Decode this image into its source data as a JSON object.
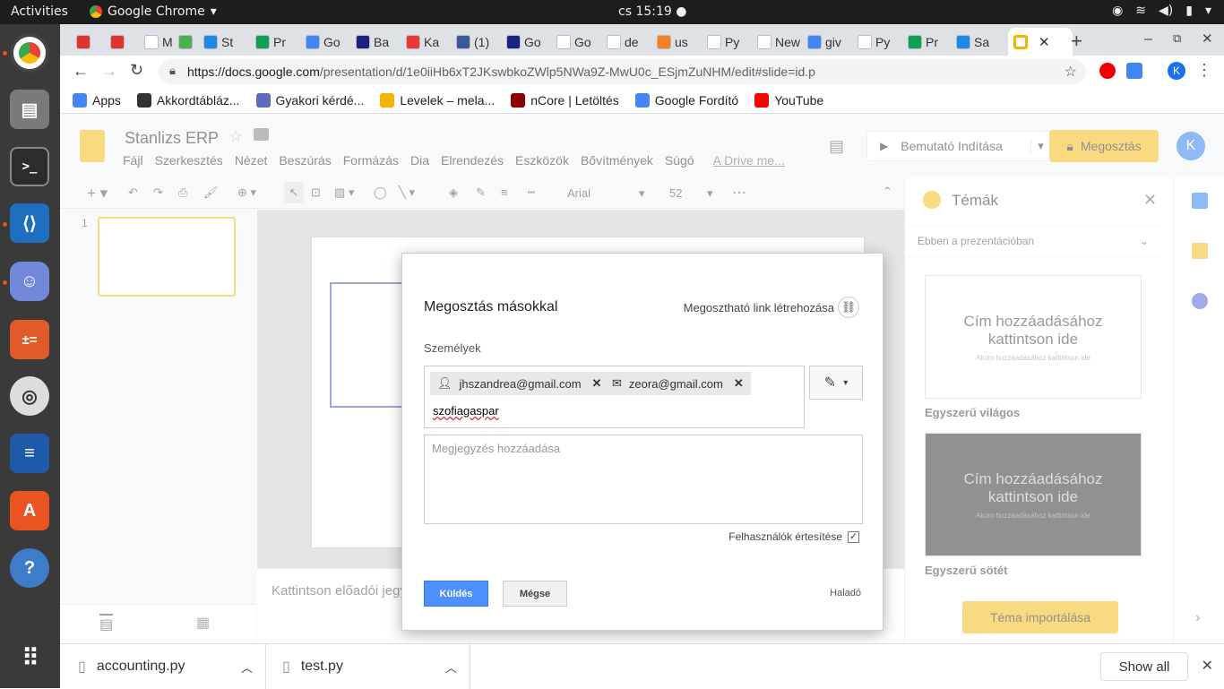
{
  "topbar": {
    "activities": "Activities",
    "app": "Google Chrome",
    "clock": "cs 15:19"
  },
  "tabs": [
    {
      "label": "",
      "color": "#d33"
    },
    {
      "label": "",
      "color": "#d33"
    },
    {
      "label": "M",
      "color": "#fff"
    },
    {
      "label": "",
      "color": "#4caf50"
    },
    {
      "label": "St",
      "color": "#1e88e5"
    },
    {
      "label": "Pr",
      "color": "#0f9d58"
    },
    {
      "label": "Go",
      "color": "#4285f4"
    },
    {
      "label": "Ba",
      "color": "#1a237e"
    },
    {
      "label": "Ka",
      "color": "#e53935"
    },
    {
      "label": "(1)",
      "color": "#3b5998"
    },
    {
      "label": "Go",
      "color": "#1a237e"
    },
    {
      "label": "Go",
      "color": "#fff"
    },
    {
      "label": "de",
      "color": "#fff"
    },
    {
      "label": "us",
      "color": "#f48024"
    },
    {
      "label": "Py",
      "color": "#fff"
    },
    {
      "label": "New T",
      "color": "#fff"
    },
    {
      "label": "giv",
      "color": "#4285f4"
    },
    {
      "label": "Py",
      "color": "#fff"
    },
    {
      "label": "Pr",
      "color": "#0f9d58"
    },
    {
      "label": "Sa",
      "color": "#1e88e5"
    }
  ],
  "url": {
    "host": "https://docs.google.com",
    "path": "/presentation/d/1e0iiHb6xT2JKswbkoZWlp5NWa9Z-MwU0c_ESjmZuNHM/edit#slide=id.p"
  },
  "bookmarks": [
    {
      "label": "Apps",
      "color": "#4285f4"
    },
    {
      "label": "Akkordtábláz...",
      "color": "#333"
    },
    {
      "label": "Gyakori kérdé...",
      "color": "#5c6bc0"
    },
    {
      "label": "Levelek – mela...",
      "color": "#f4b400"
    },
    {
      "label": "nCore | Letöltés",
      "color": "#8b0000"
    },
    {
      "label": "Google Fordító",
      "color": "#4285f4"
    },
    {
      "label": "YouTube",
      "color": "#ff0000"
    }
  ],
  "doc": {
    "title": "Stanlizs ERP",
    "menu": [
      "Fájl",
      "Szerkesztés",
      "Nézet",
      "Beszúrás",
      "Formázás",
      "Dia",
      "Elrendezés",
      "Eszközök",
      "Bővítmények",
      "Súgó"
    ],
    "drive_link": "A Drive me...",
    "present": "Bemutató Indítása",
    "share": "Megosztás",
    "avatar": "K",
    "font": "Arial",
    "font_size": "52",
    "slide_number": "1",
    "notes_placeholder": "Kattintson előadói jegy"
  },
  "themes": {
    "title": "Témák",
    "scope": "Ebben a prezentációban",
    "cards": [
      {
        "heading": "Cím hozzáadásához kattintson ide",
        "sub": "Alcím hozzáadásához kattintson ide",
        "name": "Egyszerű világos"
      },
      {
        "heading": "Cím hozzáadásához kattintson ide",
        "sub": "Alcím hozzáadásához kattintson ide",
        "name": "Egyszerű sötét"
      }
    ],
    "import": "Téma importálása"
  },
  "dialog": {
    "title": "Megosztás másokkal",
    "link_label": "Megosztható link létrehozása",
    "people_label": "Személyek",
    "chips": [
      "jhszandrea@gmail.com",
      "zeora@gmail.com"
    ],
    "typed": "szofiagaspar",
    "note_placeholder": "Megjegyzés hozzáadása",
    "notify_label": "Felhasználók értesítése",
    "send": "Küldés",
    "cancel": "Mégse",
    "advanced": "Haladó"
  },
  "downloads": [
    {
      "name": "accounting.py"
    },
    {
      "name": "test.py"
    }
  ],
  "show_all": "Show all"
}
